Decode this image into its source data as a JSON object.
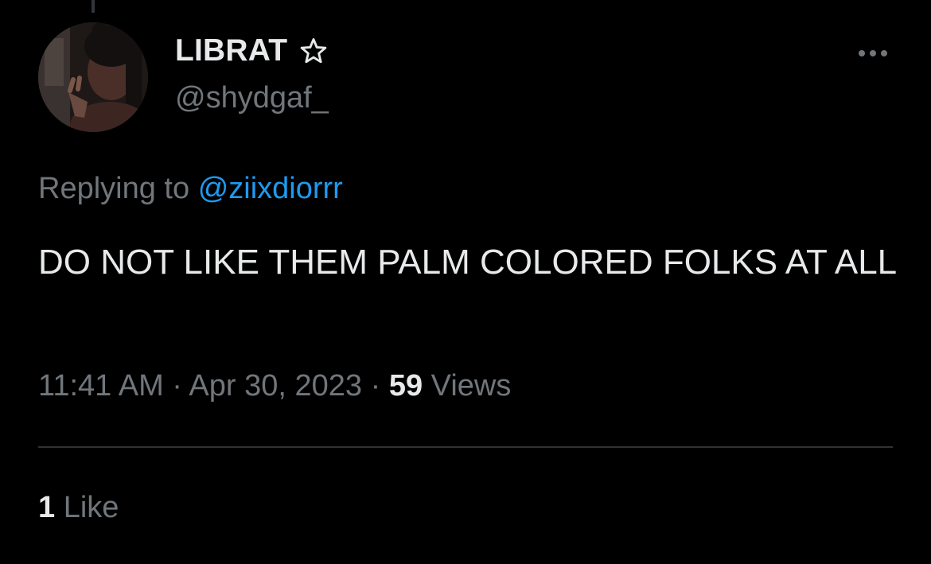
{
  "author": {
    "display_name": "LIBRAT",
    "badge_icon": "star-outline-icon",
    "handle": "@shydgaf_"
  },
  "more_menu": {
    "icon": "more-horizontal-icon"
  },
  "reply_context": {
    "prefix": "Replying to",
    "mention": "@ziixdiorrr"
  },
  "tweet": {
    "text": "DO NOT LIKE THEM PALM COLORED FOLKS AT ALL"
  },
  "meta": {
    "time": "11:41 AM",
    "separator": "·",
    "date": "Apr 30, 2023",
    "views_count": "59",
    "views_label": "Views"
  },
  "engagement": {
    "likes_count": "1",
    "likes_label": "Like"
  },
  "colors": {
    "background": "#000000",
    "text_primary": "#e7e9ea",
    "text_secondary": "#71767b",
    "link": "#1d9bf0",
    "divider": "#2f3336"
  }
}
